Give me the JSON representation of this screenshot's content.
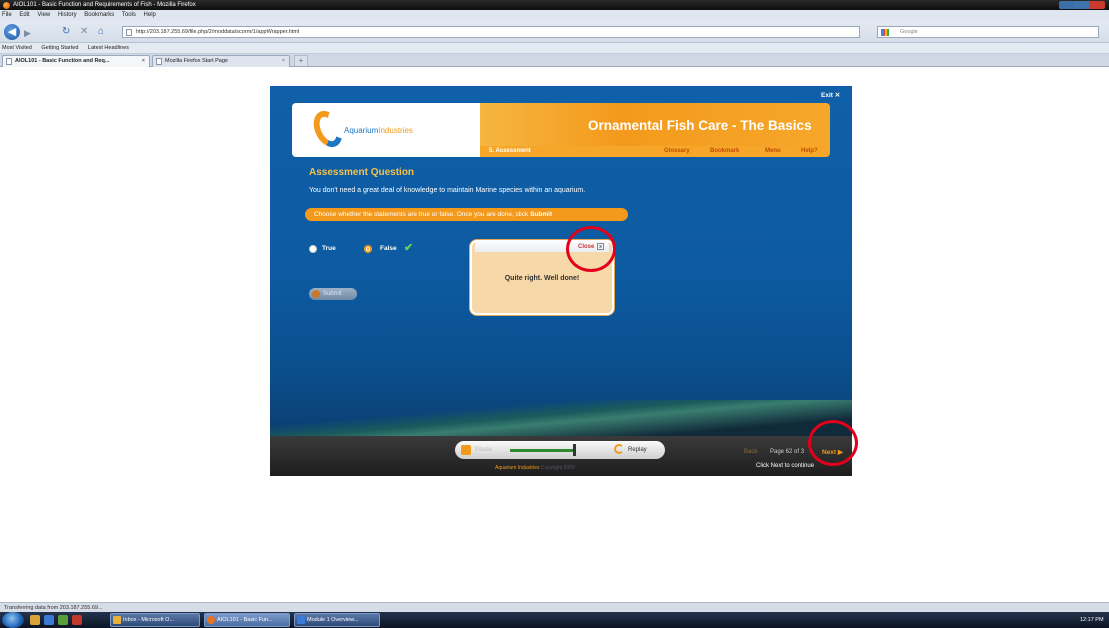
{
  "browser": {
    "window_title": "AIOL101 - Basic Function and Requirements of Fish - Mozilla Firefox",
    "menu": [
      "File",
      "Edit",
      "View",
      "History",
      "Bookmarks",
      "Tools",
      "Help"
    ],
    "url": "http://203.187.255.69/file.php/2/moddata/scorm/1/appWrapper.html",
    "search_engine": "Google",
    "bookmarks": [
      "Most Visited",
      "Getting Started",
      "Latest Headlines"
    ],
    "tabs": [
      {
        "label": "AIOL101 - Basic Function and Req..."
      },
      {
        "label": "Mozilla Firefox Start Page"
      }
    ],
    "status": "Transferring data from 203.187.255.69..."
  },
  "course": {
    "exit_label": "Exit",
    "logo_text_main": "Aquarium",
    "logo_text_suffix": "Industries",
    "title": "Ornamental Fish Care - The Basics",
    "section": "5. Assessment",
    "nav": [
      "Glossary",
      "Bookmark",
      "Menu",
      "Help?"
    ],
    "question_heading": "Assessment Question",
    "question_text": "You don't need a great deal of knowledge to maintain Marine species within an aquarium.",
    "instruction": "Choose whether the statements are true or false. Once you are done, click",
    "instruction_action": "Submit",
    "options": [
      "True",
      "False"
    ],
    "selected_option": "False",
    "submit_label": "Submit",
    "feedback": {
      "close_label": "Close",
      "message": "Quite right. Well done!"
    }
  },
  "controls": {
    "pause_label": "Pause",
    "replay_label": "Replay",
    "progress": 1.0,
    "copyright_brand": "Aquarium Industries",
    "copyright_text": "Copyright 2009",
    "back_label": "Back",
    "page_counter": "Page 62 of 3",
    "next_label": "Next",
    "continue_text": "Click Next to continue"
  },
  "taskbar": {
    "items": [
      "Inbox - Microsoft O...",
      "AIOL101 - Basic Fun...",
      "Module 1 Overview..."
    ],
    "clock": "12:17 PM"
  },
  "colors": {
    "accent_orange": "#f39a1c",
    "stage_blue": "#0f60a8",
    "highlight_red": "#e3001b"
  }
}
